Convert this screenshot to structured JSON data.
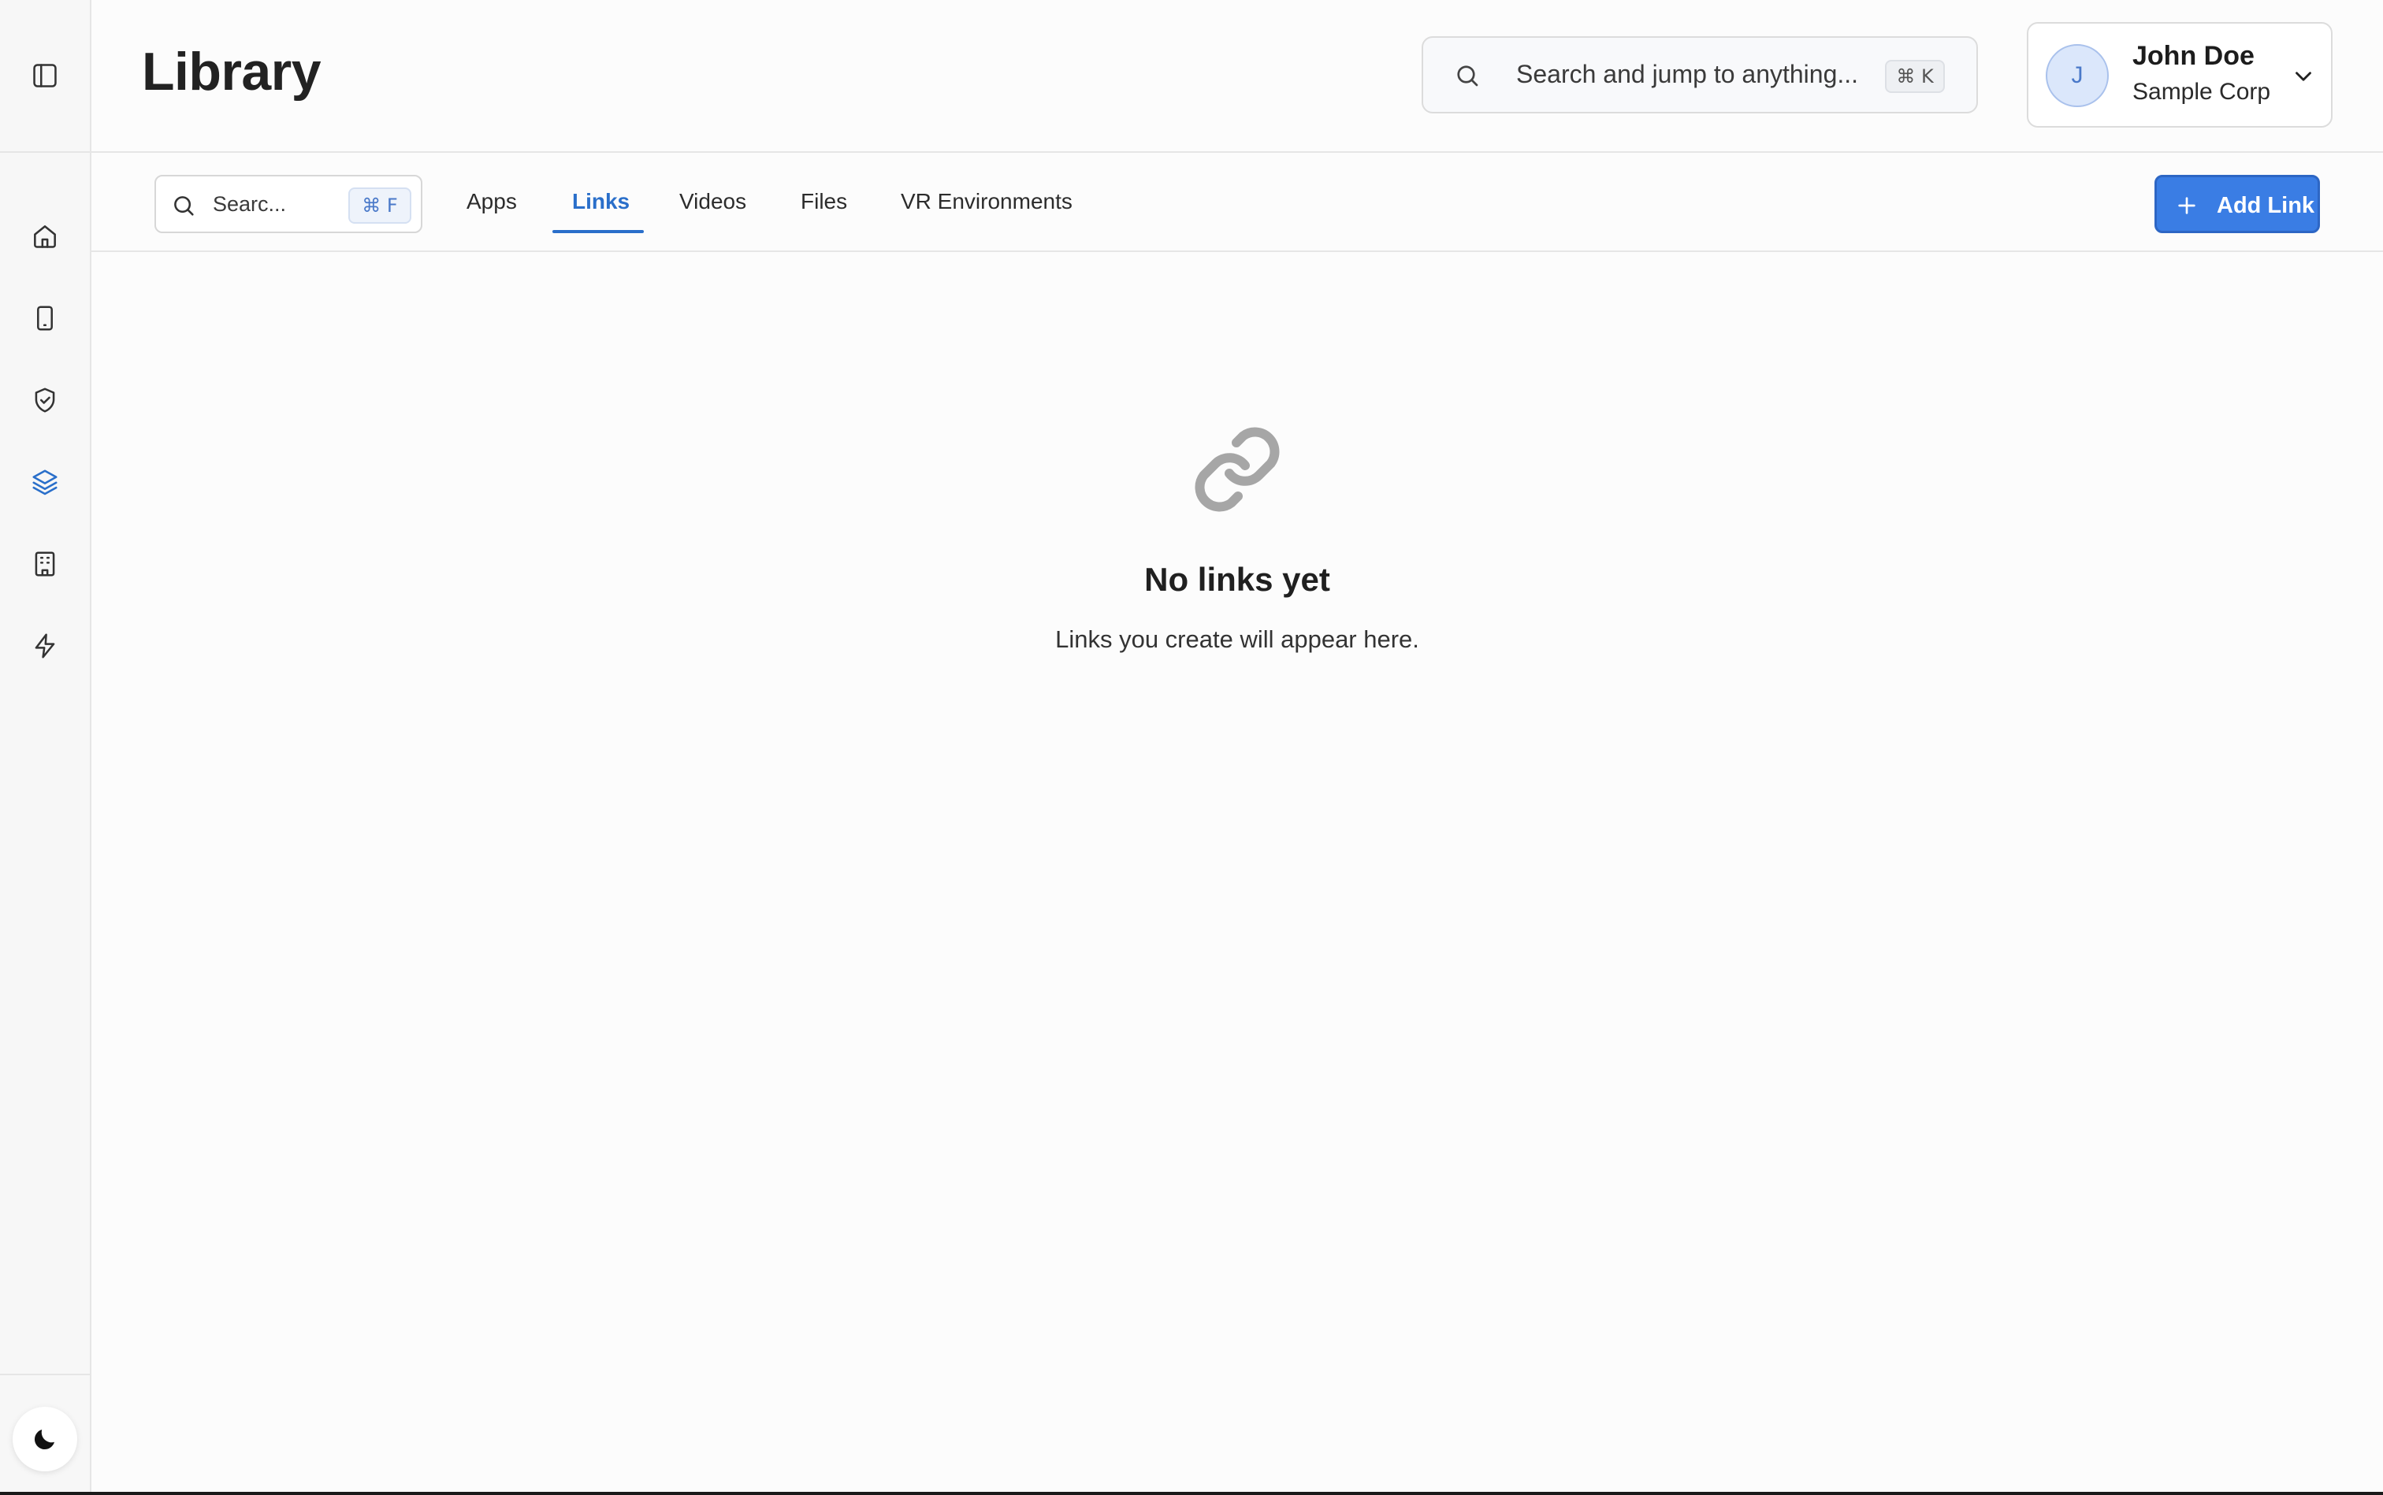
{
  "header": {
    "title": "Library",
    "global_search": {
      "placeholder": "Search and jump to anything...",
      "shortcut": "⌘ K",
      "icon": "search-icon"
    },
    "user": {
      "initial": "J",
      "name": "John Doe",
      "organization": "Sample Corp",
      "menu_icon": "chevron-down-icon"
    }
  },
  "sidebar": {
    "toggle_icon": "sidebar-toggle-icon",
    "items": [
      {
        "icon": "home-icon",
        "active": false
      },
      {
        "icon": "device-icon",
        "active": false
      },
      {
        "icon": "shield-check-icon",
        "active": false
      },
      {
        "icon": "layers-icon",
        "active": true
      },
      {
        "icon": "building-icon",
        "active": false
      },
      {
        "icon": "bolt-icon",
        "active": false
      }
    ],
    "theme_icon": "moon-icon"
  },
  "toolbar": {
    "search": {
      "placeholder": "Searc...",
      "shortcut": "⌘ F"
    },
    "tabs": [
      {
        "label": "Apps",
        "active": false
      },
      {
        "label": "Links",
        "active": true
      },
      {
        "label": "Videos",
        "active": false
      },
      {
        "label": "Files",
        "active": false
      },
      {
        "label": "VR Environments",
        "active": false
      }
    ],
    "add_button": {
      "label": "Add Link",
      "icon": "plus-icon"
    }
  },
  "empty_state": {
    "icon": "link-icon",
    "title": "No links yet",
    "subtitle": "Links you create will appear here."
  },
  "colors": {
    "accent": "#2a6fca",
    "button": "#3a7de4",
    "sidebar_bg": "#f7f7f7",
    "page_bg": "#fcfcfc"
  }
}
